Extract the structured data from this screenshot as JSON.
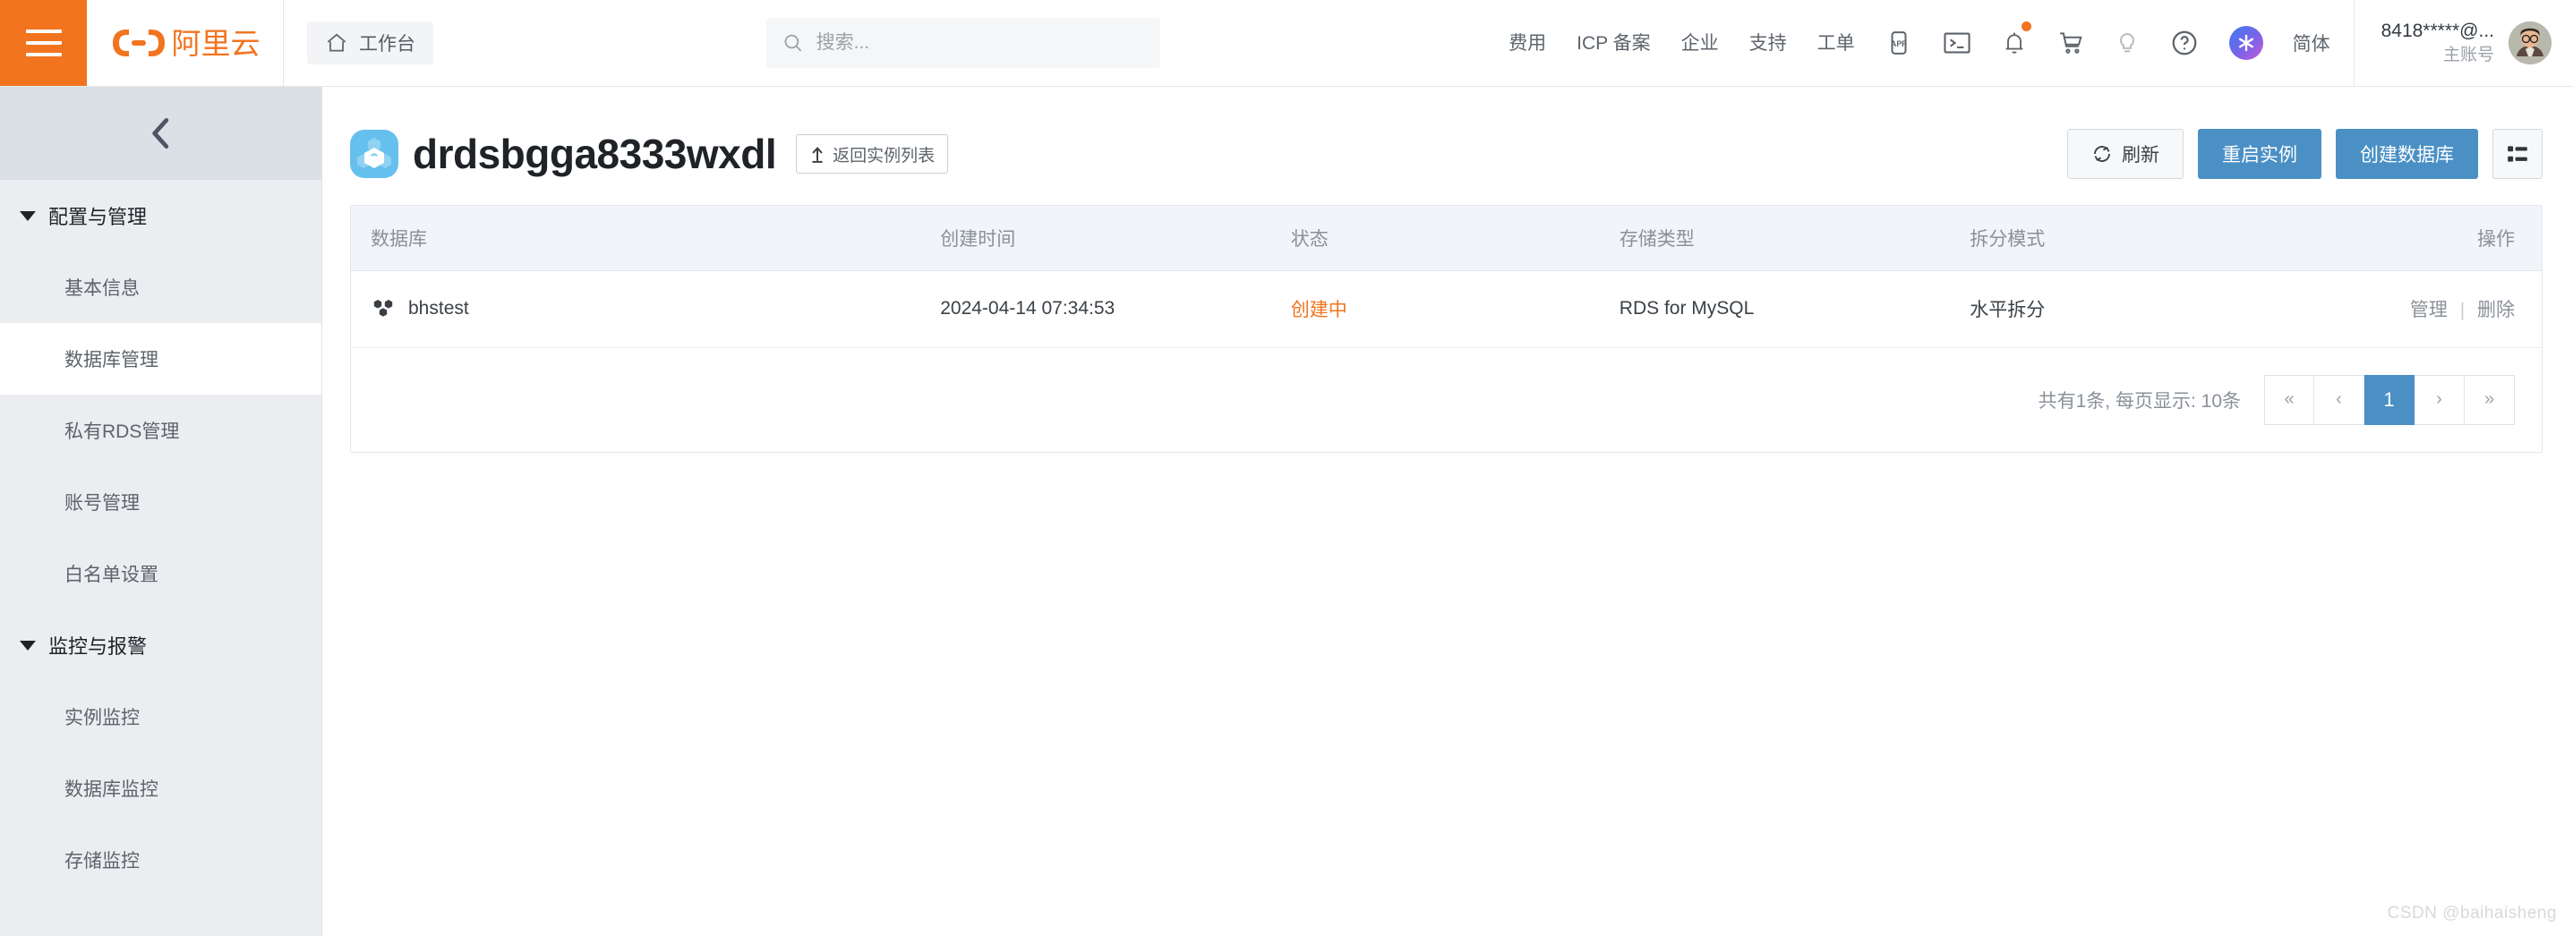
{
  "topbar": {
    "menu_icon": "hamburger-icon",
    "brand": {
      "logo_icon": "aliyun-logo-icon",
      "name": "阿里云"
    },
    "workbench": {
      "icon": "home-icon",
      "label": "工作台"
    },
    "search": {
      "icon": "search-icon",
      "value": "",
      "placeholder": "搜索..."
    },
    "nav_links": [
      {
        "label": "费用"
      },
      {
        "label": "ICP 备案"
      },
      {
        "label": "企业"
      },
      {
        "label": "支持"
      },
      {
        "label": "工单"
      }
    ],
    "nav_icons": [
      {
        "name": "app-icon",
        "badge": false
      },
      {
        "name": "terminal-icon",
        "badge": false
      },
      {
        "name": "bell-icon",
        "badge": true
      },
      {
        "name": "cart-icon",
        "badge": false
      },
      {
        "name": "lightbulb-icon",
        "badge": false
      },
      {
        "name": "help-circle-icon",
        "badge": false
      }
    ],
    "ai_assistant": {
      "icon": "ai-sparkle-icon"
    },
    "language": "简体",
    "user": {
      "name": "8418*****@...",
      "role": "主账号",
      "avatar": "user-avatar"
    }
  },
  "sidebar": {
    "collapse_icon": "chevron-left-icon",
    "groups": [
      {
        "title": "配置与管理",
        "items": [
          {
            "label": "基本信息",
            "active": false
          },
          {
            "label": "数据库管理",
            "active": true
          },
          {
            "label": "私有RDS管理",
            "active": false
          },
          {
            "label": "账号管理",
            "active": false
          },
          {
            "label": "白名单设置",
            "active": false
          }
        ]
      },
      {
        "title": "监控与报警",
        "items": [
          {
            "label": "实例监控",
            "active": false
          },
          {
            "label": "数据库监控",
            "active": false
          },
          {
            "label": "存储监控",
            "active": false
          }
        ]
      }
    ]
  },
  "page": {
    "instance_icon": "drds-instance-icon",
    "instance_name": "drdsbgga8333wxdl",
    "back_button": {
      "icon": "back-arrow-icon",
      "label": "返回实例列表"
    },
    "actions": {
      "refresh": {
        "icon": "refresh-icon",
        "label": "刷新"
      },
      "restart": {
        "label": "重启实例"
      },
      "create_db": {
        "label": "创建数据库"
      },
      "list_view": {
        "icon": "list-view-icon"
      }
    }
  },
  "table": {
    "columns": [
      "数据库",
      "创建时间",
      "状态",
      "存储类型",
      "拆分模式",
      "操作"
    ],
    "rows": [
      {
        "icon": "database-cluster-icon",
        "name": "bhstest",
        "created_at": "2024-04-14 07:34:53",
        "status": "创建中",
        "status_color": "#F2741F",
        "storage_type": "RDS for MySQL",
        "split_mode": "水平拆分",
        "actions": {
          "manage": "管理",
          "separator": "|",
          "delete": "删除"
        }
      }
    ]
  },
  "pagination": {
    "summary": "共有1条, 每页显示: 10条",
    "first": "«",
    "prev": "‹",
    "current_page": "1",
    "next": "›",
    "last": "»"
  },
  "watermark": "CSDN @baihaisheng",
  "colors": {
    "brand_orange": "#F2741F",
    "primary_blue": "#4a90C4",
    "status_orange": "#F2741F",
    "sidebar_bg": "#ebedf0"
  }
}
